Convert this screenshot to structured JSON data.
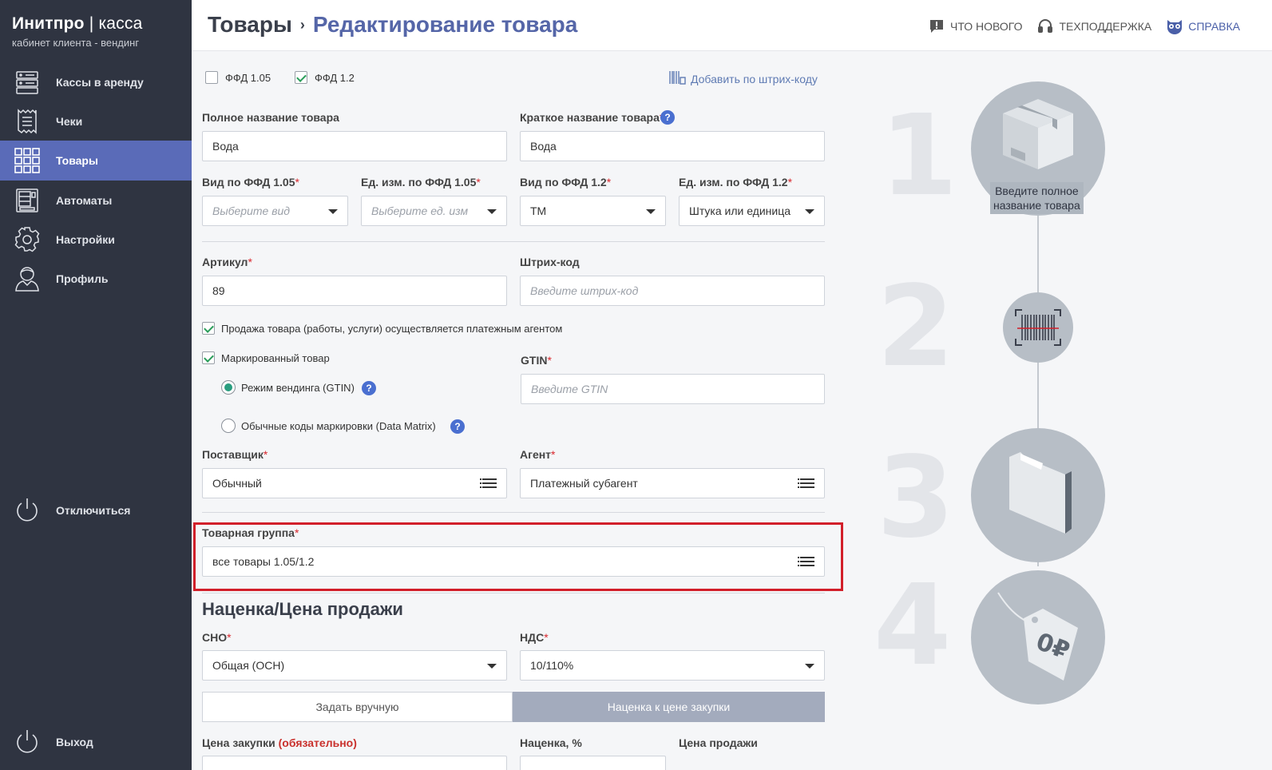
{
  "brand": {
    "name_bold": "Инитпро",
    "name_sep": " | ",
    "name_light": "касса",
    "subtitle": "кабинет клиента - вендинг"
  },
  "nav": {
    "rent": "Кассы в аренду",
    "receipts": "Чеки",
    "goods": "Товары",
    "machines": "Автоматы",
    "settings": "Настройки",
    "profile": "Профиль",
    "disconnect": "Отключиться",
    "logout": "Выход"
  },
  "header": {
    "crumb_root": "Товары",
    "crumb_sep": "›",
    "crumb_current": "Редактирование товара",
    "whats_new": "Что нового",
    "support": "Техподдержка",
    "help": "Справка"
  },
  "form": {
    "ffd105_label": "ФФД 1.05",
    "ffd105_checked": false,
    "ffd12_label": "ФФД 1.2",
    "ffd12_checked": true,
    "add_by_barcode": "Добавить по штрих-коду",
    "full_name_label": "Полное название товара",
    "full_name_value": "Вода",
    "short_name_label": "Краткое название товара",
    "short_name_value": "Вода",
    "kind105_label": "Вид по ФФД 1.05",
    "kind105_placeholder": "Выберите вид",
    "unit105_label": "Ед. изм. по ФФД 1.05",
    "unit105_placeholder": "Выберите ед. изм",
    "kind12_label": "Вид по ФФД 1.2",
    "kind12_value": "ТМ",
    "unit12_label": "Ед. изм. по ФФД 1.2",
    "unit12_value": "Штука или единица",
    "article_label": "Артикул",
    "article_value": "89",
    "barcode_label": "Штрих-код",
    "barcode_placeholder": "Введите штрих-код",
    "agent_sale_label": "Продажа товара (работы, услуги) осуществляется платежным агентом",
    "marked_label": "Маркированный товар",
    "gtin_label": "GTIN",
    "gtin_placeholder": "Введите GTIN",
    "mode_vending": "Режим вендинга (GTIN)",
    "mode_datamatrix": "Обычные коды маркировки (Data Matrix)",
    "supplier_label": "Поставщик",
    "supplier_value": "Обычный",
    "agent_label": "Агент",
    "agent_value": "Платежный субагент",
    "group_label": "Товарная группа",
    "group_value": "все товары 1.05/1.2",
    "pricing_title": "Наценка/Цена продажи",
    "sno_label": "СНО",
    "sno_value": "Общая (ОСН)",
    "vat_label": "НДС",
    "vat_value": "10/110%",
    "tab_manual": "Задать вручную",
    "tab_markup": "Наценка к цене закупки",
    "purchase_label": "Цена закупки",
    "purchase_required": "(обязательно)",
    "markup_label": "Наценка, %",
    "sale_price_label": "Цена продажи",
    "required_mark": "*",
    "help_mark": "?"
  },
  "steps": {
    "n1": "1",
    "n2": "2",
    "n3": "3",
    "n4": "4",
    "note1_line1": "Введите полное",
    "note1_line2": "название товара"
  },
  "colors": {
    "sidebar": "#2f3441",
    "active": "#5a6bb8",
    "accent": "#5566a8",
    "highlight": "#d21f2a",
    "tab_active": "#a3abbd"
  }
}
